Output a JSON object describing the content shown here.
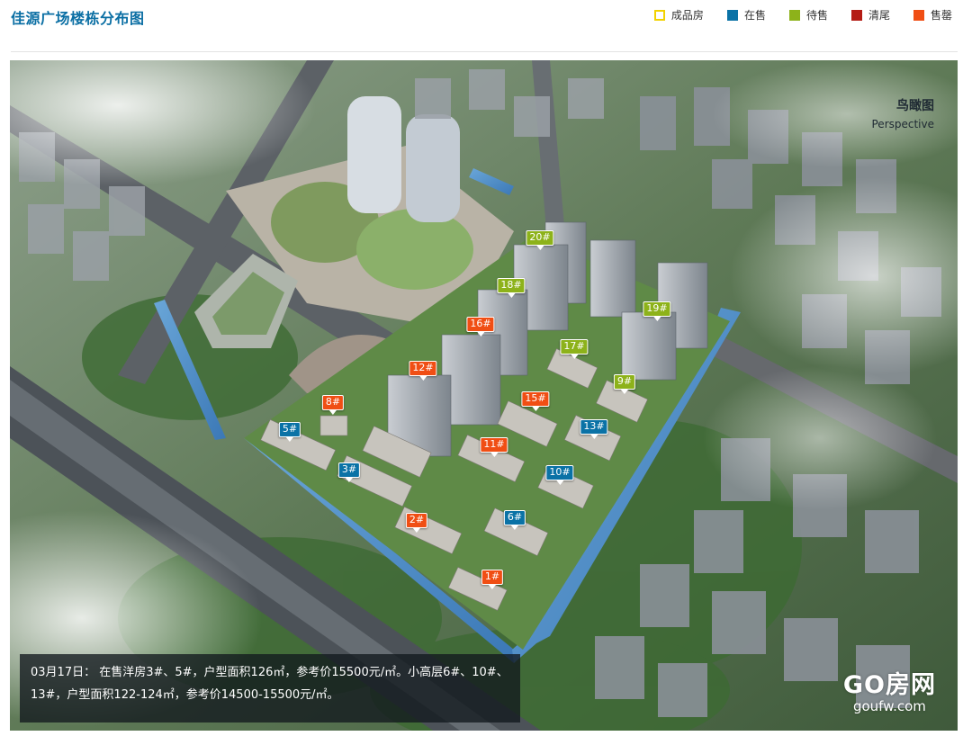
{
  "page": {
    "title": "佳源广场楼栋分布图"
  },
  "legend": [
    {
      "label": "成品房",
      "color": "#ffffff",
      "border": "#f2d200"
    },
    {
      "label": "在售",
      "color": "#0a72a6",
      "border": "#0a72a6"
    },
    {
      "label": "待售",
      "color": "#8db21a",
      "border": "#8db21a"
    },
    {
      "label": "清尾",
      "color": "#b41c14",
      "border": "#b41c14"
    },
    {
      "label": "售罄",
      "color": "#f04e14",
      "border": "#f04e14"
    }
  ],
  "perspective": {
    "cn": "鸟瞰图",
    "en": "Perspective"
  },
  "buildings": [
    {
      "label": "20#",
      "status": "待售"
    },
    {
      "label": "18#",
      "status": "待售"
    },
    {
      "label": "16#",
      "status": "售罄"
    },
    {
      "label": "19#",
      "status": "待售"
    },
    {
      "label": "17#",
      "status": "待售"
    },
    {
      "label": "12#",
      "status": "售罄"
    },
    {
      "label": "9#",
      "status": "待售"
    },
    {
      "label": "15#",
      "status": "售罄"
    },
    {
      "label": "8#",
      "status": "售罄"
    },
    {
      "label": "13#",
      "status": "在售"
    },
    {
      "label": "5#",
      "status": "在售"
    },
    {
      "label": "11#",
      "status": "售罄"
    },
    {
      "label": "3#",
      "status": "在售"
    },
    {
      "label": "10#",
      "status": "在售"
    },
    {
      "label": "6#",
      "status": "在售"
    },
    {
      "label": "2#",
      "status": "售罄"
    },
    {
      "label": "1#",
      "status": "售罄"
    }
  ],
  "note": {
    "line1": "03月17日： 在售洋房3#、5#，户型面积126㎡，参考价15500元/㎡。小高层6#、10#、",
    "line2": "13#，户型面积122-124㎡，参考价14500-15500元/㎡。"
  },
  "watermark": {
    "main": "GO房网",
    "sub": "goufw.com"
  }
}
